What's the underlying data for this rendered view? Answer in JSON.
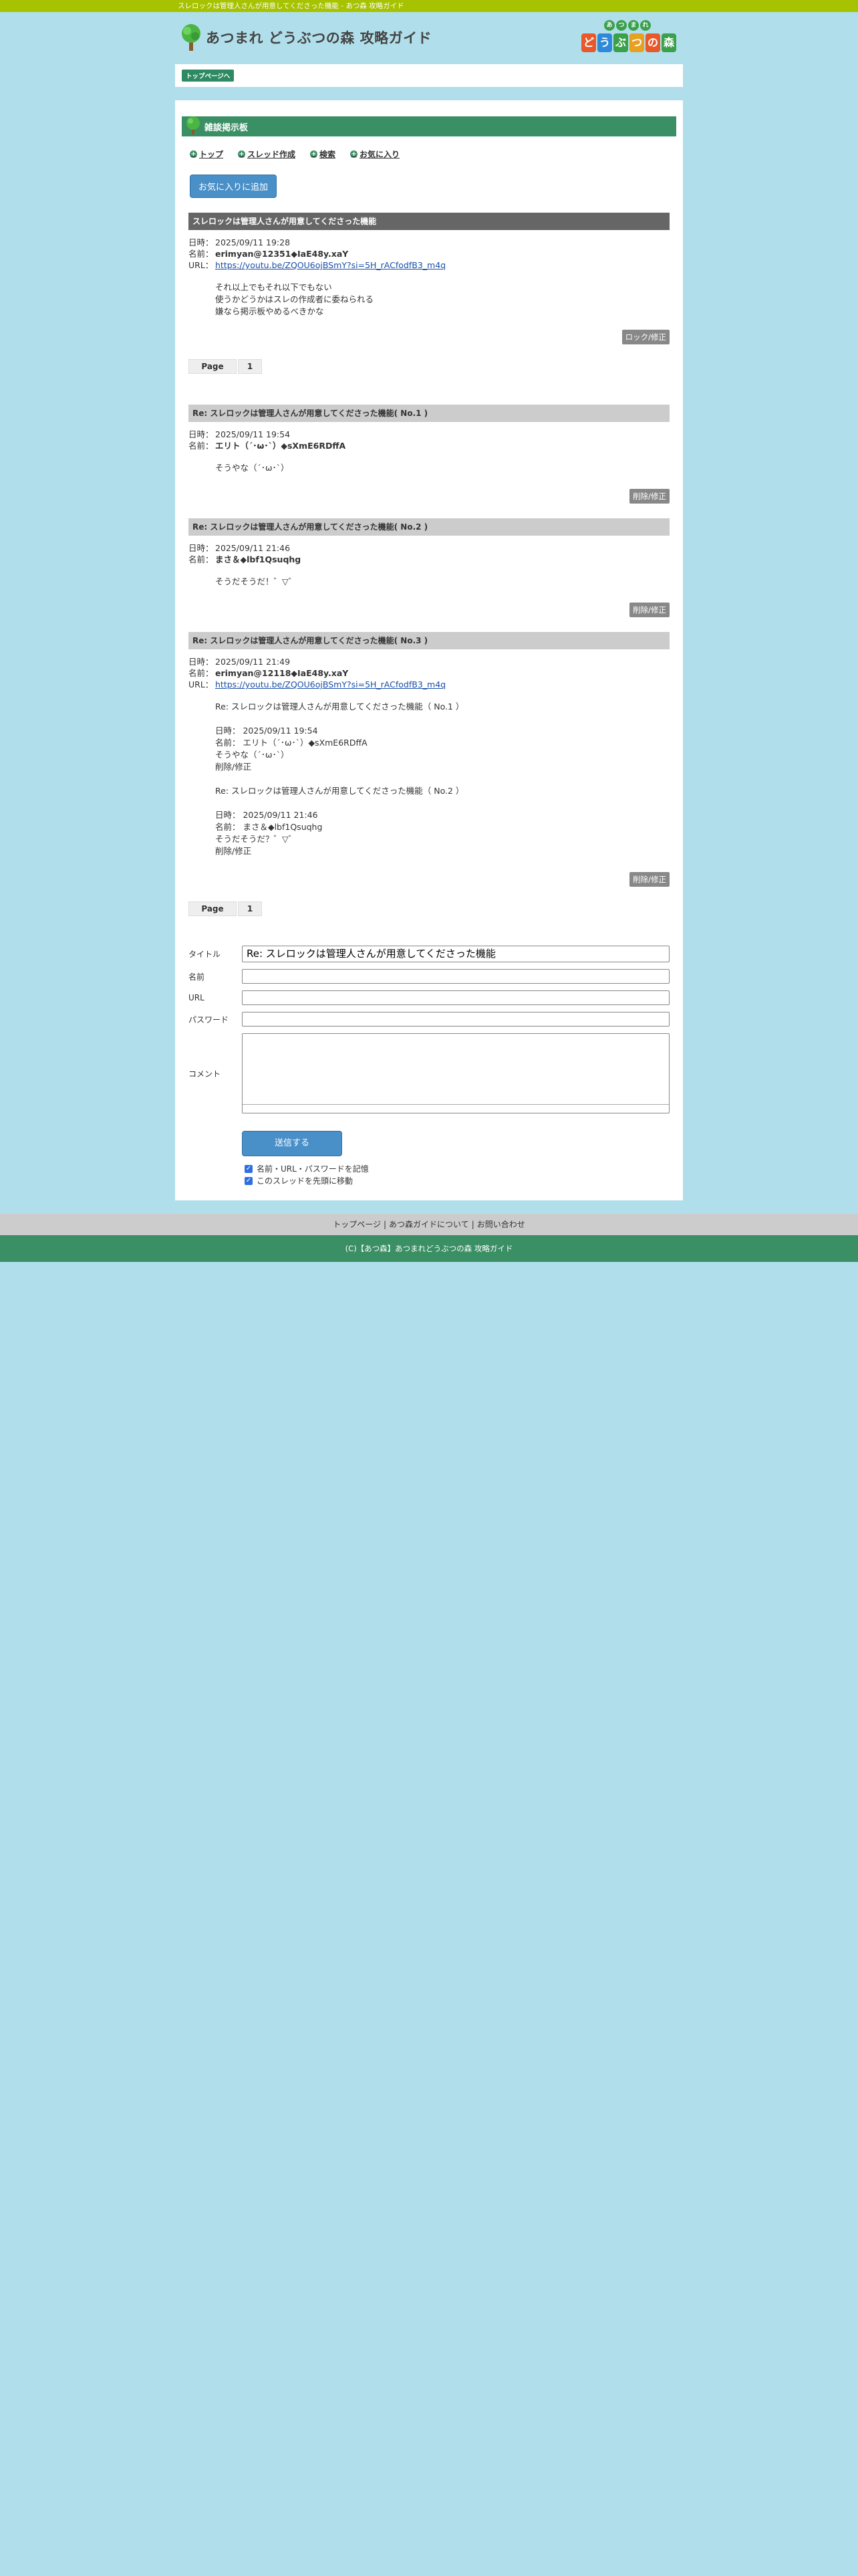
{
  "topbar": {
    "text": "スレロックは管理人さんが用意してくださった機能 - あつ森 攻略ガイド"
  },
  "header": {
    "site_title": "あつまれ どうぶつの森 攻略ガイド",
    "logo_small": [
      "あ",
      "つ",
      "ま",
      "れ"
    ],
    "logo_big": [
      "ど",
      "う",
      "ぶ",
      "つ",
      "の",
      "森"
    ]
  },
  "breadcrumb": {
    "top": "トップページへ"
  },
  "board": {
    "title": "雑談掲示板",
    "nav": [
      "トップ",
      "スレッド作成",
      "検索",
      "お気に入り"
    ],
    "fav_button": "お気に入りに追加"
  },
  "labels": {
    "date": "日時：",
    "name": "名前：",
    "url": "URL：",
    "page": "Page",
    "lock": "ロック/修正",
    "delete": "削除/修正"
  },
  "thread": {
    "title": "スレロックは管理人さんが用意してくださった機能",
    "date": "2025/09/11 19:28",
    "name": "erimyan@12351◆IaE48y.xaY",
    "url": "https://youtu.be/ZQOU6ojBSmY?si=5H_rACfodfB3_m4q",
    "body": "それ以上でもそれ以下でもない\n使うかどうかはスレの作成者に委ねられる\n嫌なら掲示板やめるべきかな",
    "page_num": "1"
  },
  "replies": [
    {
      "title": "Re: スレロックは管理人さんが用意してくださった機能( No.1 )",
      "date": "2025/09/11 19:54",
      "name": "エリト（´･ω･`）◆sXmE6RDffA",
      "url": "",
      "body": "そうやな（´･ω･`）"
    },
    {
      "title": "Re: スレロックは管理人さんが用意してくださった機能( No.2 )",
      "date": "2025/09/11 21:46",
      "name": "まさ＆◆lbf1Qsuqhg",
      "url": "",
      "body": "そうだそうだ！゛▽゛"
    },
    {
      "title": "Re: スレロックは管理人さんが用意してくださった機能( No.3 )",
      "date": "2025/09/11 21:49",
      "name": "erimyan@12118◆IaE48y.xaY",
      "url": "https://youtu.be/ZQOU6ojBSmY?si=5H_rACfodfB3_m4q",
      "body": "Re: スレロックは管理人さんが用意してくださった機能（ No.1 ）\n\n日時： 2025/09/11 19:54\n名前： エリト（´･ω･`）◆sXmE6RDffA\nそうやな（´･ω･`）\n削除/修正\n\nRe: スレロックは管理人さんが用意してくださった機能（ No.2 ）\n\n日時： 2025/09/11 21:46\n名前： まさ＆◆lbf1Qsuqhg\nそうだそうだ？゛▽゛\n削除/修正"
    }
  ],
  "form": {
    "title_label": "タイトル",
    "title_value": "Re: スレロックは管理人さんが用意してくださった機能",
    "name_label": "名前",
    "url_label": "URL",
    "password_label": "パスワード",
    "comment_label": "コメント",
    "submit": "送信する",
    "remember": "名前・URL・パスワードを記憶",
    "move_top": "このスレッドを先頭に移動"
  },
  "footer": {
    "links": [
      "トップページ",
      "あつ森ガイドについて",
      "お問い合わせ"
    ],
    "copy": "(C)【あつ森】あつまれどうぶつの森 攻略ガイド"
  },
  "colors": {
    "green": "#3a8f64",
    "topbar": "#a7c200",
    "bg": "#b0dfeb",
    "blue_btn": "#4a90c8"
  }
}
